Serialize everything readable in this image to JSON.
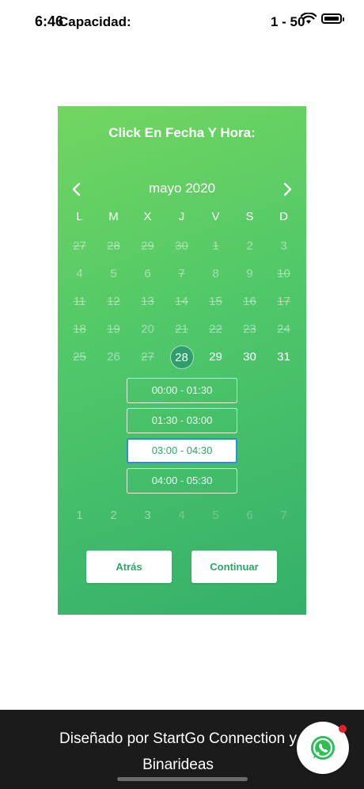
{
  "status_bar": {
    "time": "6:46",
    "carrier_text": "Capacidad:",
    "right_text": "1 - 50"
  },
  "booking": {
    "title": "Click En Fecha Y Hora:",
    "month": "mayo 2020",
    "weekdays": [
      "L",
      "M",
      "X",
      "J",
      "V",
      "S",
      "D"
    ],
    "weeks": [
      [
        "27",
        "28",
        "29",
        "30",
        "1",
        "2",
        "3"
      ],
      [
        "4",
        "5",
        "6",
        "7",
        "8",
        "9",
        "10"
      ],
      [
        "11",
        "12",
        "13",
        "14",
        "15",
        "16",
        "17"
      ],
      [
        "18",
        "19",
        "20",
        "21",
        "22",
        "23",
        "24"
      ],
      [
        "25",
        "26",
        "27",
        "28",
        "29",
        "30",
        "31"
      ]
    ],
    "selected_date": "28",
    "time_slots": [
      "00:00 - 01:30",
      "01:30 - 03:00",
      "03:00 - 04:30",
      "04:00 - 05:30"
    ],
    "selected_slot": "03:00 - 04:30",
    "week_numbers": [
      "1",
      "2",
      "3",
      "4",
      "5",
      "6",
      "7"
    ],
    "back_label": "Atrás",
    "continue_label": "Continuar"
  },
  "footer": {
    "line1": "Diseñado por StartGo Connection y",
    "line2": "Binarideas"
  },
  "icons": {
    "prev": "chevron-left-icon",
    "next": "chevron-right-icon",
    "chat": "whatsapp-icon"
  },
  "colors": {
    "accent_green": "#4fc769",
    "selected_date": "#2e9e6a",
    "selected_slot_border": "#2f8be0",
    "notification_dot": "#e3212b"
  }
}
